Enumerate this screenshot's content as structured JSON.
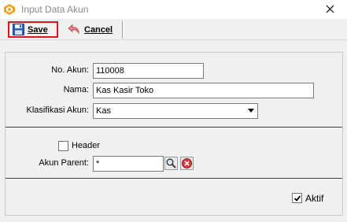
{
  "window": {
    "title": "Input Data Akun",
    "icon": "app-logo-icon",
    "close_icon": "close-icon"
  },
  "toolbar": {
    "save_label": "Save",
    "save_icon": "floppy-disk-icon",
    "cancel_label": "Cancel",
    "cancel_icon": "undo-arrow-icon"
  },
  "form": {
    "no_akun": {
      "label": "No. Akun:",
      "value": "110008"
    },
    "nama": {
      "label": "Nama:",
      "value": "Kas Kasir Toko"
    },
    "klasifikasi": {
      "label": "Klasifikasi Akun:",
      "selected": "Kas"
    },
    "header": {
      "label": "Header",
      "checked": false
    },
    "akun_parent": {
      "label": "Akun Parent:",
      "value": "*",
      "search_icon": "magnifier-icon",
      "clear_icon": "clear-icon"
    },
    "aktif": {
      "label": "Aktif",
      "checked": true
    }
  },
  "colors": {
    "save_highlight": "#e3141a",
    "title_text": "#8a8a8a"
  }
}
